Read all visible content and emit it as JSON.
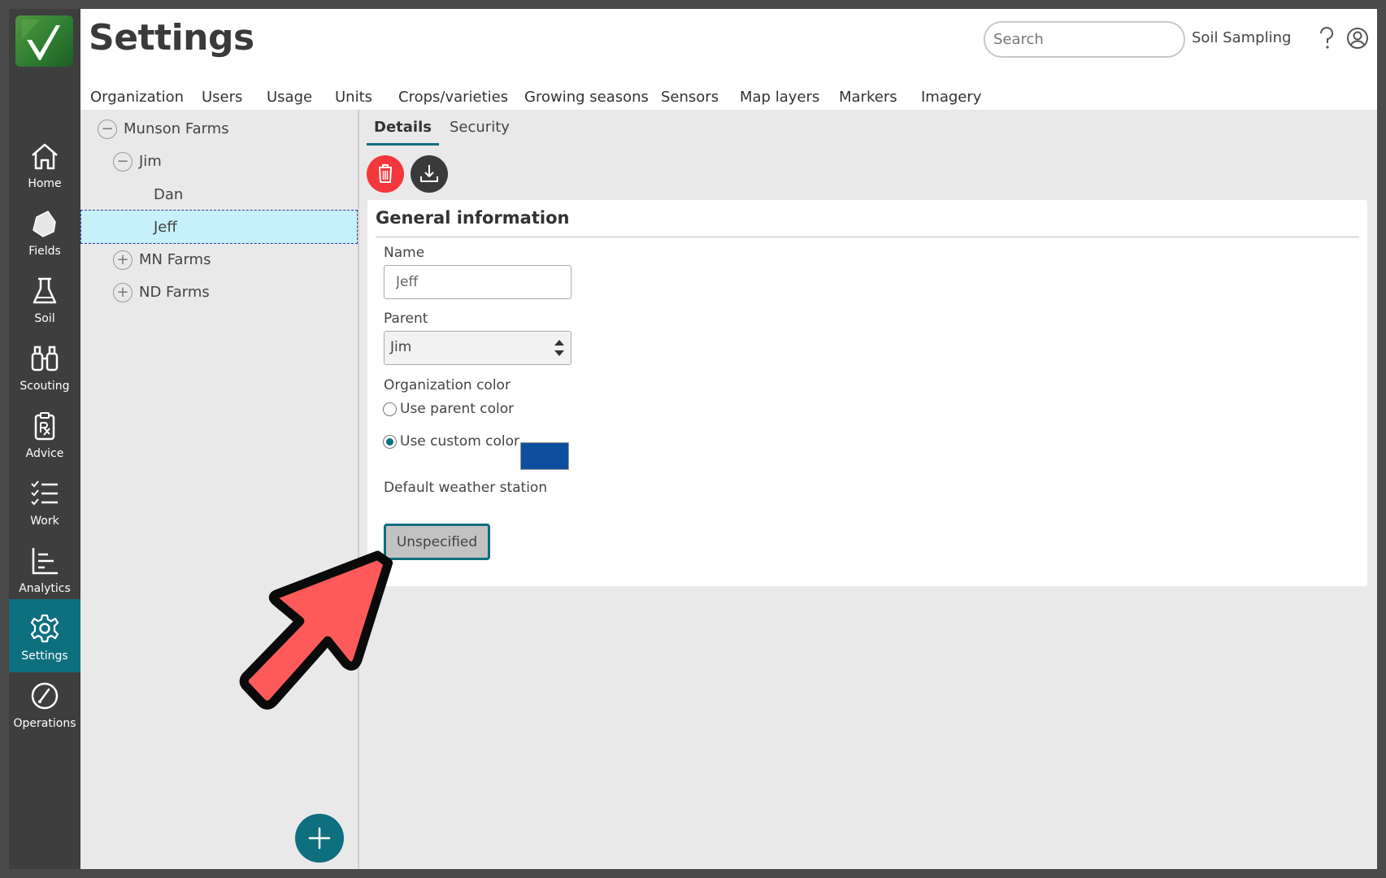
{
  "app": {
    "page_title": "Settings"
  },
  "header": {
    "search_placeholder": "Search",
    "context": "Soil Sampling"
  },
  "nav": {
    "items": [
      {
        "label": "Home",
        "icon": "home-icon"
      },
      {
        "label": "Fields",
        "icon": "field-icon"
      },
      {
        "label": "Soil",
        "icon": "flask-icon"
      },
      {
        "label": "Scouting",
        "icon": "binoculars-icon"
      },
      {
        "label": "Advice",
        "icon": "prescription-icon"
      },
      {
        "label": "Work",
        "icon": "checklist-icon"
      },
      {
        "label": "Analytics",
        "icon": "chart-icon"
      },
      {
        "label": "Settings",
        "icon": "gear-icon",
        "active": true
      },
      {
        "label": "Operations",
        "icon": "gauge-icon"
      }
    ]
  },
  "tabs": [
    "Organization",
    "Users",
    "Usage",
    "Units",
    "Crops/varieties",
    "Growing seasons",
    "Sensors",
    "Map layers",
    "Markers",
    "Imagery"
  ],
  "tree": {
    "items": [
      {
        "label": "Munson Farms",
        "toggle": "−"
      },
      {
        "label": "Jim",
        "toggle": "−"
      },
      {
        "label": "Dan"
      },
      {
        "label": "Jeff",
        "selected": true
      },
      {
        "label": "MN Farms",
        "toggle": "+"
      },
      {
        "label": "ND Farms",
        "toggle": "+"
      }
    ]
  },
  "detail": {
    "sub_tabs": [
      "Details",
      "Security"
    ],
    "card_title": "General information",
    "name_label": "Name",
    "name_value": "Jeff",
    "parent_label": "Parent",
    "parent_value": "Jim",
    "color_label": "Organization color",
    "use_parent_label": "Use parent color",
    "use_custom_label": "Use custom color",
    "custom_color": "#0d4f9e",
    "weather_label": "Default weather station",
    "weather_value": "Unspecified"
  },
  "colors": {
    "accent": "#0e6f7f",
    "delete": "#f4373b",
    "pointer": "#ff5a5a"
  }
}
